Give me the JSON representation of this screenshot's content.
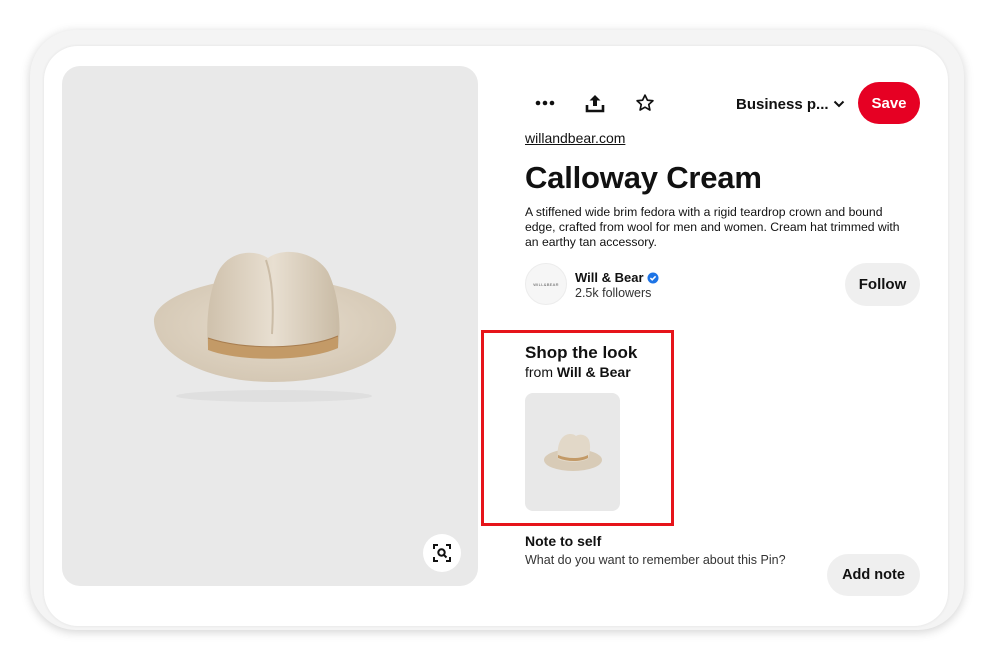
{
  "toolbar": {
    "more_icon": "more-horizontal-icon",
    "share_icon": "share-icon",
    "favorite_icon": "star-icon",
    "board_label": "Business p...",
    "save_label": "Save"
  },
  "pin": {
    "source": "willandbear.com",
    "title": "Calloway Cream",
    "description": "A stiffened wide brim fedora with a rigid teardrop crown and bound edge, crafted from wool for men and women. Cream hat trimmed with an earthy tan accessory."
  },
  "creator": {
    "avatar_text": "WILL&BEAR",
    "name": "Will & Bear",
    "followers": "2.5k followers",
    "follow_label": "Follow"
  },
  "shop": {
    "title": "Shop the look",
    "from_prefix": "from",
    "from_brand": "Will & Bear"
  },
  "note": {
    "title": "Note to self",
    "prompt": "What do you want to remember about this Pin?",
    "add_label": "Add note"
  },
  "colors": {
    "save_red": "#e60023",
    "highlight_red": "#e6141a",
    "verified_blue": "#1d74e6"
  }
}
